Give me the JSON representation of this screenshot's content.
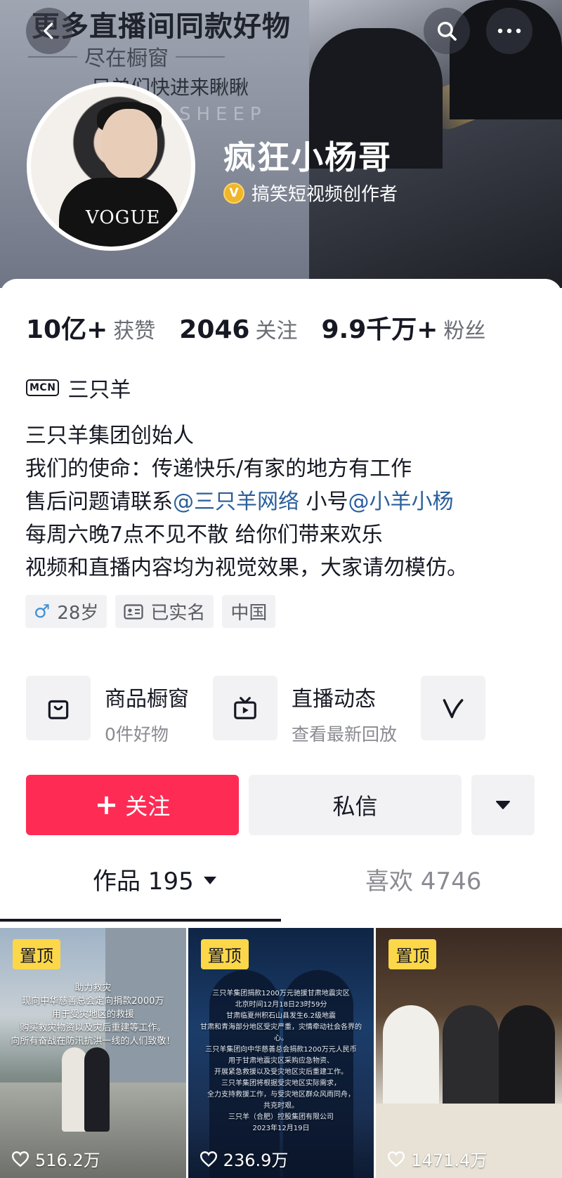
{
  "banner": {
    "headline": "更多直播间同款好物",
    "subline": "尽在橱窗",
    "line3": "兄弟们快进来瞅瞅",
    "watermark": "SHEEP"
  },
  "profile": {
    "nickname": "疯狂小杨哥",
    "verify_label": "搞笑短视频创作者"
  },
  "stats": [
    {
      "value": "10亿+",
      "label": "获赞"
    },
    {
      "value": "2046",
      "label": "关注"
    },
    {
      "value": "9.9千万+",
      "label": "粉丝"
    }
  ],
  "mcn": {
    "badge": "MCN",
    "name": "三只羊"
  },
  "bio": {
    "line1": "三只羊集团创始人",
    "line2": "我们的使命：传递快乐/有家的地方有工作",
    "line3_prefix": "售后问题请联系",
    "line3_mention1": "@三只羊网络",
    "line3_mid": " 小号",
    "line3_mention2": "@小羊小杨",
    "line4": "每周六晚7点不见不散  给你们带来欢乐",
    "line5": "视频和直播内容均为视觉效果，大家请勿模仿。"
  },
  "tags": {
    "gender_symbol": "♂",
    "age": "28岁",
    "verified": "已实名",
    "region": "中国"
  },
  "features": [
    {
      "title": "商品橱窗",
      "subtitle": "0件好物",
      "icon": "bag-icon"
    },
    {
      "title": "直播动态",
      "subtitle": "查看最新回放",
      "icon": "tv-icon"
    }
  ],
  "actions": {
    "follow_plus": "+",
    "follow_label": "关注",
    "message_label": "私信"
  },
  "tabs": {
    "works": "作品 195",
    "likes": "喜欢 4746"
  },
  "videos": [
    {
      "pin": "置顶",
      "likes": "516.2万",
      "overlay": [
        "助力救灾",
        "现向中华慈善总会定向捐款2000万",
        "用于受灾地区的救援",
        "购买救灾物资以及灾后重建等工作。",
        "向所有奋战在防汛抗洪一线的人们致敬！"
      ]
    },
    {
      "pin": "置顶",
      "likes": "236.9万",
      "overlay": [
        "三只羊集团捐款1200万元驰援甘肃地震灾区",
        "北京时间12月18日23时59分",
        "甘肃临夏州积石山县发生6.2级地震",
        "甘肃和青海部分地区受灾严重，灾情牵动社会各界的心。",
        "三只羊集团向中华慈善总会捐款1200万元人民币",
        "用于甘肃地震灾区采购应急物资、",
        "开展紧急救援以及受灾地区灾后重建工作。",
        "三只羊集团将根据受灾地区实际需求，",
        "全力支持救援工作，与受灾地区群众风雨同舟，",
        "共克时艰。",
        "三只羊（合肥）控股集团有限公司",
        "2023年12月19日"
      ]
    },
    {
      "pin": "置顶",
      "likes": "1471.4万",
      "overlay": []
    }
  ]
}
